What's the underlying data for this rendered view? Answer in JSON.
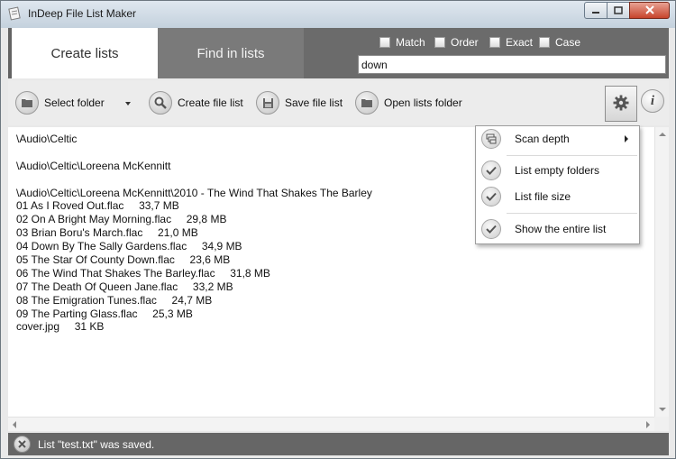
{
  "window": {
    "title": "InDeep File List Maker",
    "controls": {
      "minimize": "minimize-icon",
      "maximize": "maximize-icon",
      "close": "close-icon"
    }
  },
  "tabs": [
    {
      "label": "Create lists",
      "active": true
    },
    {
      "label": "Find in lists",
      "active": false
    }
  ],
  "search": {
    "options": [
      {
        "label": "Match",
        "checked": false
      },
      {
        "label": "Order",
        "checked": false
      },
      {
        "label": "Exact",
        "checked": false
      },
      {
        "label": "Case",
        "checked": false
      }
    ],
    "value": "down"
  },
  "toolbar": {
    "select_folder": "Select folder",
    "create_file_list": "Create file list",
    "save_file_list": "Save file list",
    "open_lists_folder": "Open lists folder"
  },
  "list_lines": [
    "\\Audio\\Celtic",
    "",
    "\\Audio\\Celtic\\Loreena McKennitt",
    "",
    "\\Audio\\Celtic\\Loreena McKennitt\\2010 - The Wind That Shakes The Barley",
    "01 As I Roved Out.flac     33,7 MB",
    "02 On A Bright May Morning.flac     29,8 MB",
    "03 Brian Boru's March.flac     21,0 MB",
    "04 Down By The Sally Gardens.flac     34,9 MB",
    "05 The Star Of County Down.flac     23,6 MB",
    "06 The Wind That Shakes The Barley.flac     31,8 MB",
    "07 The Death Of Queen Jane.flac     33,2 MB",
    "08 The Emigration Tunes.flac     24,7 MB",
    "09 The Parting Glass.flac     25,3 MB",
    "cover.jpg     31 KB"
  ],
  "settings_menu": {
    "scan_depth": "Scan depth",
    "list_empty_folders": "List empty folders",
    "list_file_size": "List file size",
    "show_entire_list": "Show the entire list"
  },
  "status": {
    "message": "List \"test.txt\" was saved."
  },
  "colors": {
    "header_bg": "#636363",
    "tab_active": "#ffffff",
    "status_bg": "#666666",
    "close_red": "#c7442c"
  }
}
